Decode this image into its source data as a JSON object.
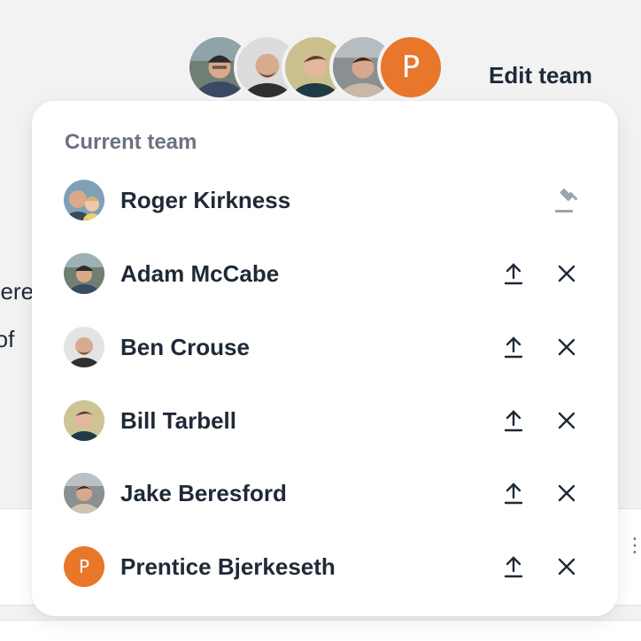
{
  "header": {
    "edit_team_label": "Edit team",
    "avatar_stack": [
      {
        "name": "avatar-stack-adam",
        "kind": "photo"
      },
      {
        "name": "avatar-stack-ben",
        "kind": "photo"
      },
      {
        "name": "avatar-stack-bill",
        "kind": "photo"
      },
      {
        "name": "avatar-stack-jake",
        "kind": "photo"
      },
      {
        "name": "avatar-stack-prentice",
        "kind": "letter",
        "letter": "P"
      }
    ]
  },
  "background": {
    "fragment_1": "nere",
    "fragment_2": "rof"
  },
  "panel": {
    "title": "Current team",
    "members": [
      {
        "name": "Roger Kirkness",
        "role_icon": "gavel-icon",
        "letter": ""
      },
      {
        "name": "Adam McCabe",
        "actions": [
          "upload-icon",
          "close-icon"
        ],
        "letter": ""
      },
      {
        "name": "Ben Crouse",
        "actions": [
          "upload-icon",
          "close-icon"
        ],
        "letter": ""
      },
      {
        "name": "Bill Tarbell",
        "actions": [
          "upload-icon",
          "close-icon"
        ],
        "letter": ""
      },
      {
        "name": "Jake Beresford",
        "actions": [
          "upload-icon",
          "close-icon"
        ],
        "letter": ""
      },
      {
        "name": "Prentice Bjerkeseth",
        "actions": [
          "upload-icon",
          "close-icon"
        ],
        "letter": "P"
      }
    ]
  },
  "colors": {
    "accent_orange": "#e8762b",
    "text_primary": "#1f2937",
    "text_muted": "#6b7280",
    "icon_disabled": "#9ca3af",
    "page_bg": "#f2f2f3"
  }
}
